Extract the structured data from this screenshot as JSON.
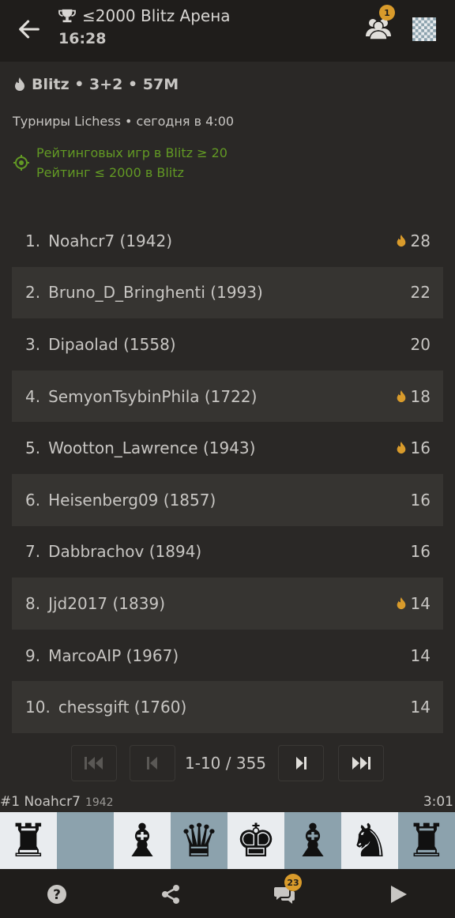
{
  "header": {
    "title": "≤2000 Blitz Арена",
    "time_left": "16:28",
    "friends_badge": "1"
  },
  "tournament": {
    "perf": "Blitz • 3+2 • 57M",
    "organizer": "Турниры Lichess • сегодня в 4:00",
    "conditions": [
      "Рейтинговых игр в Blitz ≥ 20",
      "Рейтинг ≤ 2000 в Blitz"
    ]
  },
  "standings": [
    {
      "rank": "1.",
      "player": "Noahcr7 (1942)",
      "score": "28",
      "fire": true
    },
    {
      "rank": "2.",
      "player": "Bruno_D_Bringhenti (1993)",
      "score": "22",
      "fire": false
    },
    {
      "rank": "3.",
      "player": "Dipaolad (1558)",
      "score": "20",
      "fire": false
    },
    {
      "rank": "4.",
      "player": "SemyonTsybinPhila (1722)",
      "score": "18",
      "fire": true
    },
    {
      "rank": "5.",
      "player": "Wootton_Lawrence (1943)",
      "score": "16",
      "fire": true
    },
    {
      "rank": "6.",
      "player": "Heisenberg09 (1857)",
      "score": "16",
      "fire": false
    },
    {
      "rank": "7.",
      "player": "Dabbrachov (1894)",
      "score": "16",
      "fire": false
    },
    {
      "rank": "8.",
      "player": "Jjd2017 (1839)",
      "score": "14",
      "fire": true
    },
    {
      "rank": "9.",
      "player": "MarcoAIP (1967)",
      "score": "14",
      "fire": false
    },
    {
      "rank": "10.",
      "player": "chessgift (1760)",
      "score": "14",
      "fire": false
    }
  ],
  "pagination": {
    "text": "1-10 / 355"
  },
  "featured": {
    "leader": "#1 Noahcr7",
    "rating": "1942",
    "clock": "3:01",
    "pieces": [
      "♜",
      "",
      "♝",
      "♛",
      "♚",
      "♝",
      "♞",
      "♜"
    ]
  },
  "bottom": {
    "chat_badge": "23"
  },
  "colors": {
    "accent": "#d99b2b",
    "condition_green": "#629924",
    "background": "#2a2826"
  }
}
